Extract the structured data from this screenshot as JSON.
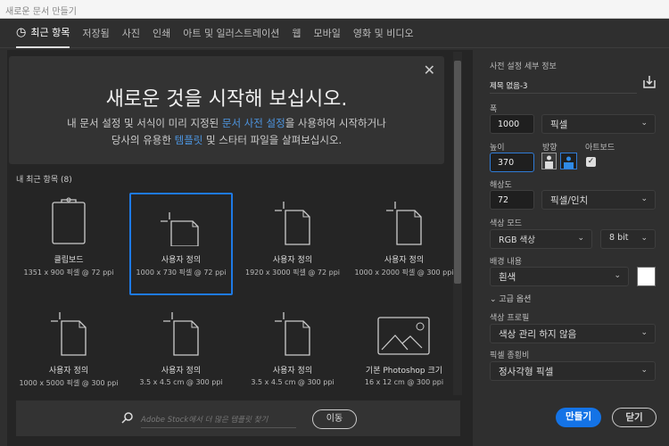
{
  "window": {
    "title": "새로운 문서 만들기"
  },
  "tabs": [
    "최근 항목",
    "저장됨",
    "사진",
    "인쇄",
    "아트 및 일러스트레이션",
    "웹",
    "모바일",
    "영화 및 비디오"
  ],
  "banner": {
    "title": "새로운 것을 시작해 보십시오.",
    "line1_a": "내 문서 설정 및 서식이 미리 지정된 ",
    "line1_link": "문서 사전 설정",
    "line1_b": "을 사용하여 시작하거나",
    "line2_a": "당사의 유용한 ",
    "line2_link": "템플릿",
    "line2_b": " 및 스타터 파일을 살펴보십시오."
  },
  "recent": {
    "label": "내 최근 항목",
    "count": "(8)",
    "items": [
      {
        "name": "클립보드",
        "size": "1351 x 900 픽셀 @ 72 ppi",
        "icon": "clipboard"
      },
      {
        "name": "사용자 정의",
        "size": "1000 x 730 픽셀 @ 72 ppi",
        "icon": "landscape-doc",
        "selected": true
      },
      {
        "name": "사용자 정의",
        "size": "1920 x 3000 픽셀 @ 72 ppi",
        "icon": "portrait-doc"
      },
      {
        "name": "사용자 정의",
        "size": "1000 x 2000 픽셀 @ 300 ppi",
        "icon": "portrait-doc"
      },
      {
        "name": "사용자 정의",
        "size": "1000 x 5000 픽셀 @ 300 ppi",
        "icon": "portrait-doc"
      },
      {
        "name": "사용자 정의",
        "size": "3.5 x 4.5 cm @ 300 ppi",
        "icon": "portrait-doc"
      },
      {
        "name": "사용자 정의",
        "size": "3.5 x 4.5 cm @ 300 ppi",
        "icon": "portrait-doc"
      },
      {
        "name": "기본 Photoshop 크기",
        "size": "16 x 12 cm @ 300 ppi",
        "icon": "image"
      }
    ]
  },
  "search": {
    "placeholder": "Adobe Stock에서 더 많은 템플릿 찾기",
    "go": "이동"
  },
  "preset": {
    "header": "사전 설정 세부 정보",
    "name": "제목 없음-3",
    "width_label": "폭",
    "width": "1000",
    "width_unit": "픽셀",
    "height_label": "높이",
    "height": "370",
    "orient_label": "방향",
    "artboard_label": "아트보드",
    "artboard": true,
    "res_label": "해상도",
    "res": "72",
    "res_unit": "픽셀/인치",
    "mode_label": "색상 모드",
    "mode": "RGB 색상",
    "bits": "8 bit",
    "bg_label": "배경 내용",
    "bg": "흰색",
    "bg_color": "#ffffff",
    "advanced": "고급 옵션",
    "profile_label": "색상 프로필",
    "profile": "색상 관리 하지 않음",
    "aspect_label": "픽셀 종횡비",
    "aspect": "정사각형 픽셀"
  },
  "buttons": {
    "create": "만들기",
    "close": "닫기"
  },
  "colors": {
    "accent": "#1473e6"
  }
}
